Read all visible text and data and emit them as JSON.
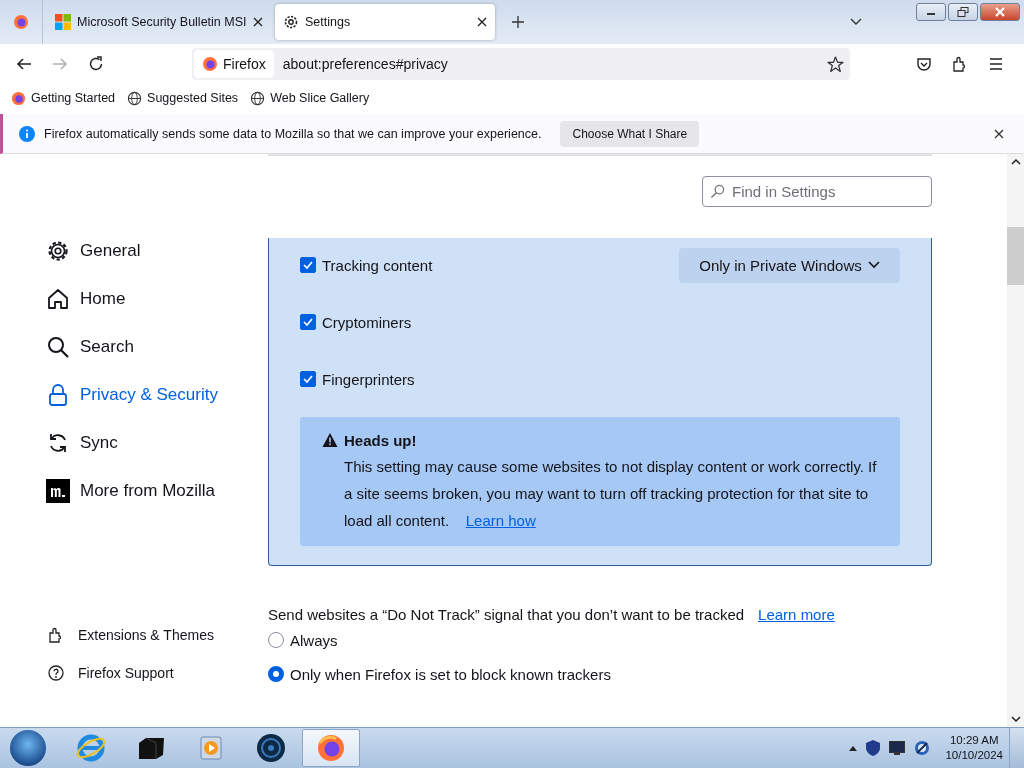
{
  "tabs": [
    {
      "title": "Microsoft Security Bulletin MSI",
      "selected": false
    },
    {
      "title": "Settings",
      "selected": true
    }
  ],
  "nav": {
    "forward_disabled": true,
    "identity": "Firefox",
    "url": "about:preferences#privacy"
  },
  "bookmarks": [
    "Getting Started",
    "Suggested Sites",
    "Web Slice Gallery"
  ],
  "notification": {
    "message": "Firefox automatically sends some data to Mozilla so that we can improve your experience.",
    "button": "Choose What I Share"
  },
  "search": {
    "placeholder": "Find in Settings"
  },
  "sidebar": {
    "items": [
      {
        "label": "General",
        "selected": false
      },
      {
        "label": "Home",
        "selected": false
      },
      {
        "label": "Search",
        "selected": false
      },
      {
        "label": "Privacy & Security",
        "selected": true
      },
      {
        "label": "Sync",
        "selected": false
      },
      {
        "label": "More from Mozilla",
        "selected": false
      }
    ],
    "footer": [
      "Extensions & Themes",
      "Firefox Support"
    ]
  },
  "blockers": [
    {
      "label": "Tracking content",
      "checked": true,
      "dropdown": "Only in Private Windows"
    },
    {
      "label": "Cryptominers",
      "checked": true
    },
    {
      "label": "Fingerprinters",
      "checked": true
    }
  ],
  "warning": {
    "title": "Heads up!",
    "body": "This setting may cause some websites to not display content or work correctly. If a site seems broken, you may want to turn off tracking protection for that site to load all content.",
    "link": "Learn how"
  },
  "do_not_track": {
    "text": "Send websites a “Do Not Track” signal that you don’t want to be tracked",
    "link": "Learn more",
    "options": [
      {
        "label": "Always",
        "selected": false
      },
      {
        "label": "Only when Firefox is set to block known trackers",
        "selected": true
      }
    ]
  },
  "taskbar": {
    "apps": [
      {
        "selected": false
      },
      {
        "selected": false
      },
      {
        "selected": false
      },
      {
        "selected": false
      },
      {
        "selected": true
      }
    ],
    "time": "10:29 AM",
    "date": "10/10/2024"
  }
}
